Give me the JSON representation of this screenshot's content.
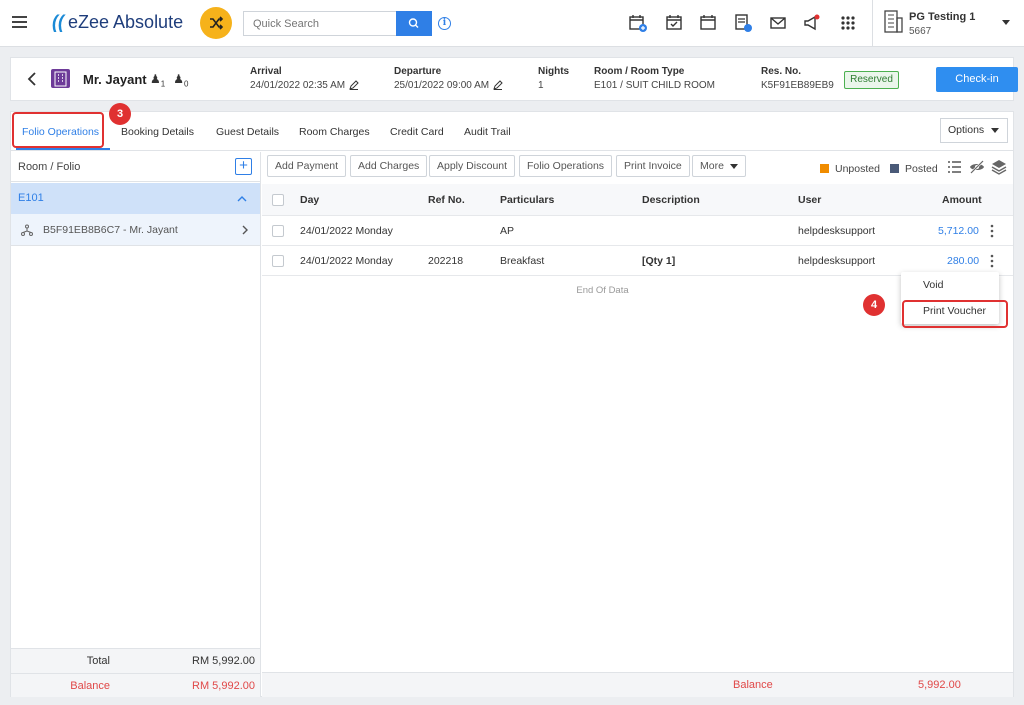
{
  "topbar": {
    "logo_text": "eZee Absolute",
    "search_placeholder": "Quick Search",
    "property_name": "PG Testing 1",
    "property_id": "5667"
  },
  "reservation": {
    "guest_name": "Mr. Jayant",
    "adults": "1",
    "children": "0",
    "arrival_label": "Arrival",
    "arrival_value": "24/01/2022 02:35 AM",
    "departure_label": "Departure",
    "departure_value": "25/01/2022 09:00 AM",
    "nights_label": "Nights",
    "nights_value": "1",
    "room_label": "Room / Room Type",
    "room_value": "E101 / SUIT CHILD ROOM",
    "res_label": "Res. No.",
    "res_value": "K5F91EB89EB9",
    "status": "Reserved",
    "checkin_label": "Check-in"
  },
  "tabs": [
    {
      "label": "Folio Operations",
      "active": true
    },
    {
      "label": "Booking Details"
    },
    {
      "label": "Guest Details"
    },
    {
      "label": "Room Charges"
    },
    {
      "label": "Credit Card"
    },
    {
      "label": "Audit Trail"
    }
  ],
  "options_label": "Options",
  "folio_panel": {
    "title": "Room / Folio",
    "room": "E101",
    "folio": "B5F91EB8B6C7 - Mr. Jayant",
    "total_label": "Total",
    "total_value": "RM 5,992.00",
    "balance_label": "Balance",
    "balance_value": "RM 5,992.00"
  },
  "toolbar": {
    "add_payment": "Add Payment",
    "add_charges": "Add Charges",
    "apply_discount": "Apply Discount",
    "folio_operations": "Folio Operations",
    "print_invoice": "Print Invoice",
    "more": "More",
    "unposted": "Unposted",
    "posted": "Posted"
  },
  "table": {
    "headers": [
      "Day",
      "Ref No.",
      "Particulars",
      "Description",
      "User",
      "Amount"
    ],
    "rows": [
      {
        "day": "24/01/2022 Monday",
        "ref": "",
        "particulars": "AP",
        "description": "",
        "user": "helpdesksupport",
        "amount": "5,712.00"
      },
      {
        "day": "24/01/2022 Monday",
        "ref": "202218",
        "particulars": "Breakfast",
        "description": "[Qty 1]",
        "user": "helpdesksupport",
        "amount": "280.00"
      }
    ],
    "end_text": "End Of Data",
    "balance_label": "Balance",
    "balance_value": "5,992.00"
  },
  "context_menu": {
    "void": "Void",
    "print_voucher": "Print Voucher"
  },
  "annotations": {
    "step3": "3",
    "step4": "4"
  },
  "colors": {
    "accent": "#2f7fe6",
    "reserved_green": "#4cb050",
    "balance_red": "#e04848",
    "unposted_orange": "#f08c00",
    "posted_slate": "#4a5a78",
    "annotation_red": "#e03131"
  }
}
